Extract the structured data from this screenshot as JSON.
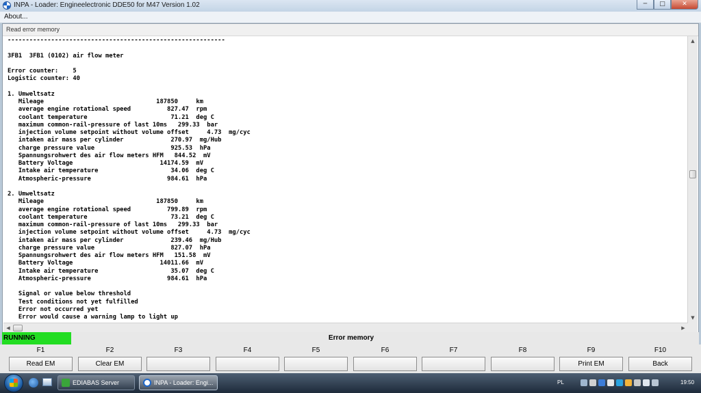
{
  "window": {
    "title": "INPA - Loader:  Engineelectronic DDE50 for M47 Version 1.02",
    "minimize": "─",
    "maximize": "□",
    "close": "✕"
  },
  "menu": {
    "about": "About..."
  },
  "section": {
    "title": "Read error memory"
  },
  "output_lines": [
    "------------------------------------------------------------",
    "",
    "3FB1  3FB1 (0102) air flow meter",
    "",
    "Error counter:    5",
    "Logistic counter: 40",
    "",
    "1. Umweltsatz",
    "   Mileage                               187850     km",
    "   average engine rotational speed          827.47  rpm",
    "   coolant temperature                       71.21  deg C",
    "   maximum common-rail-pressure of last 10ms   299.33  bar",
    "   injection volume setpoint without volume offset     4.73  mg/cyc",
    "   intaken air mass per cylinder             270.97  mg/Hub",
    "   charge pressure value                     925.53  hPa",
    "   Spannungsrohwert des air flow meters HFM   844.52  mV",
    "   Battery Voltage                        14174.59  mV",
    "   Intake air temperature                    34.06  deg C",
    "   Atmospheric-pressure                     984.61  hPa",
    "",
    "2. Umweltsatz",
    "   Mileage                               187850     km",
    "   average engine rotational speed          799.89  rpm",
    "   coolant temperature                       73.21  deg C",
    "   maximum common-rail-pressure of last 10ms   299.33  bar",
    "   injection volume setpoint without volume offset     4.73  mg/cyc",
    "   intaken air mass per cylinder             239.46  mg/Hub",
    "   charge pressure value                     827.07  hPa",
    "   Spannungsrohwert des air flow meters HFM   151.58  mV",
    "   Battery Voltage                        14011.66  mV",
    "   Intake air temperature                    35.07  deg C",
    "   Atmospheric-pressure                     984.61  hPa",
    "",
    "   Signal or value below threshold",
    "   Test conditions not yet fulfilled",
    "   Error not occurred yet",
    "   Error would cause a warning lamp to light up"
  ],
  "status": {
    "state": "RUNNING",
    "screen": "Error memory",
    "state_color": "#22dd22"
  },
  "function_keys": [
    {
      "key": "F1",
      "label": "Read EM"
    },
    {
      "key": "F2",
      "label": "Clear EM"
    },
    {
      "key": "F3",
      "label": ""
    },
    {
      "key": "F4",
      "label": ""
    },
    {
      "key": "F5",
      "label": ""
    },
    {
      "key": "F6",
      "label": ""
    },
    {
      "key": "F7",
      "label": ""
    },
    {
      "key": "F8",
      "label": ""
    },
    {
      "key": "F9",
      "label": "Print EM"
    },
    {
      "key": "F10",
      "label": "Back"
    }
  ],
  "taskbar": {
    "items": [
      {
        "label": "EDIABAS Server",
        "icon": "ediabas-icon",
        "active": false
      },
      {
        "label": "INPA - Loader:  Engi...",
        "icon": "inpa-icon",
        "active": true
      }
    ],
    "language": "PL",
    "clock": "19:50"
  }
}
